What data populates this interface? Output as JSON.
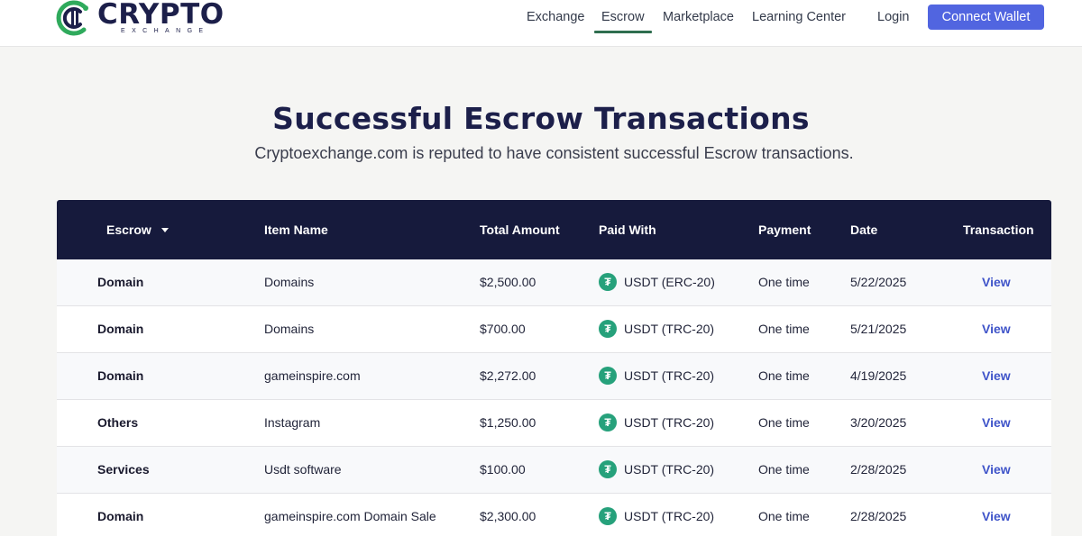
{
  "brand": {
    "name": "CRYPTO",
    "subname": "EXCHANGE"
  },
  "nav": {
    "items": [
      {
        "label": "Exchange",
        "active": false
      },
      {
        "label": "Escrow",
        "active": true
      },
      {
        "label": "Marketplace",
        "active": false
      },
      {
        "label": "Learning Center",
        "active": false
      }
    ],
    "login": "Login",
    "connect_wallet": "Connect Wallet"
  },
  "hero": {
    "title": "Successful Escrow Transactions",
    "subtitle": "Cryptoexchange.com is reputed to have consistent successful Escrow transactions."
  },
  "table": {
    "columns": {
      "escrow": "Escrow",
      "item_name": "Item Name",
      "total_amount": "Total Amount",
      "paid_with": "Paid With",
      "payment": "Payment",
      "date": "Date",
      "transaction": "Transaction"
    },
    "rows": [
      {
        "escrow": "Domain",
        "item": "Domains",
        "amount": "$2,500.00",
        "paid_with": "USDT (ERC-20)",
        "payment": "One time",
        "date": "5/22/2025",
        "action": "View"
      },
      {
        "escrow": "Domain",
        "item": "Domains",
        "amount": "$700.00",
        "paid_with": "USDT (TRC-20)",
        "payment": "One time",
        "date": "5/21/2025",
        "action": "View"
      },
      {
        "escrow": "Domain",
        "item": "gameinspire.com",
        "amount": "$2,272.00",
        "paid_with": "USDT (TRC-20)",
        "payment": "One time",
        "date": "4/19/2025",
        "action": "View"
      },
      {
        "escrow": "Others",
        "item": "Instagram",
        "amount": "$1,250.00",
        "paid_with": "USDT (TRC-20)",
        "payment": "One time",
        "date": "3/20/2025",
        "action": "View"
      },
      {
        "escrow": "Services",
        "item": "Usdt software",
        "amount": "$100.00",
        "paid_with": "USDT (TRC-20)",
        "payment": "One time",
        "date": "2/28/2025",
        "action": "View"
      },
      {
        "escrow": "Domain",
        "item": "gameinspire.com Domain Sale",
        "amount": "$2,300.00",
        "paid_with": "USDT (TRC-20)",
        "payment": "One time",
        "date": "2/28/2025",
        "action": "View"
      }
    ]
  },
  "colors": {
    "header_bg": "#161a3c",
    "accent_button": "#5165e0",
    "tether_green": "#26a17b",
    "link": "#3f54c9",
    "active_underline": "#2f6e4f"
  }
}
